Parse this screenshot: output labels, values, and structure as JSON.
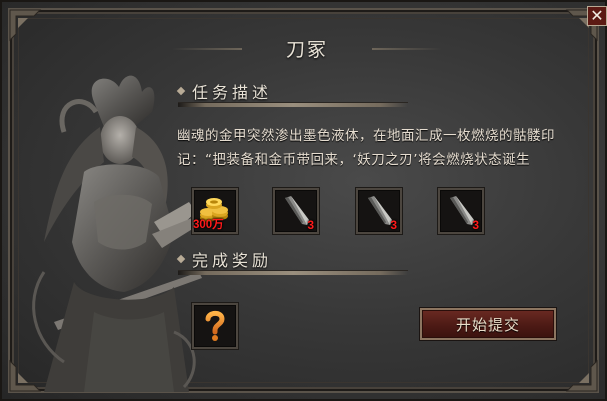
{
  "dialog": {
    "title": "刀冢",
    "close_glyph": "✕"
  },
  "task": {
    "heading": "任务描述",
    "description": "幽魂的金甲突然渗出墨色液体，在地面汇成一枚燃烧的骷髅印记：“把装备和金币带回来，‘妖刀之刃’将会燃烧状态诞生"
  },
  "requirements": [
    {
      "icon": "gold-coins-icon",
      "quantity": "300万"
    },
    {
      "icon": "blade-fragment-icon",
      "quantity": "3"
    },
    {
      "icon": "blade-fragment-icon",
      "quantity": "3"
    },
    {
      "icon": "blade-fragment-icon",
      "quantity": "3"
    }
  ],
  "reward": {
    "heading": "完成奖励",
    "item_icon": "question-mark-icon"
  },
  "actions": {
    "submit_label": "开始提交"
  },
  "colors": {
    "quantity_text": "#ff1a1a",
    "button_red": "#5c1a14",
    "text_light": "#e6ddd0"
  }
}
